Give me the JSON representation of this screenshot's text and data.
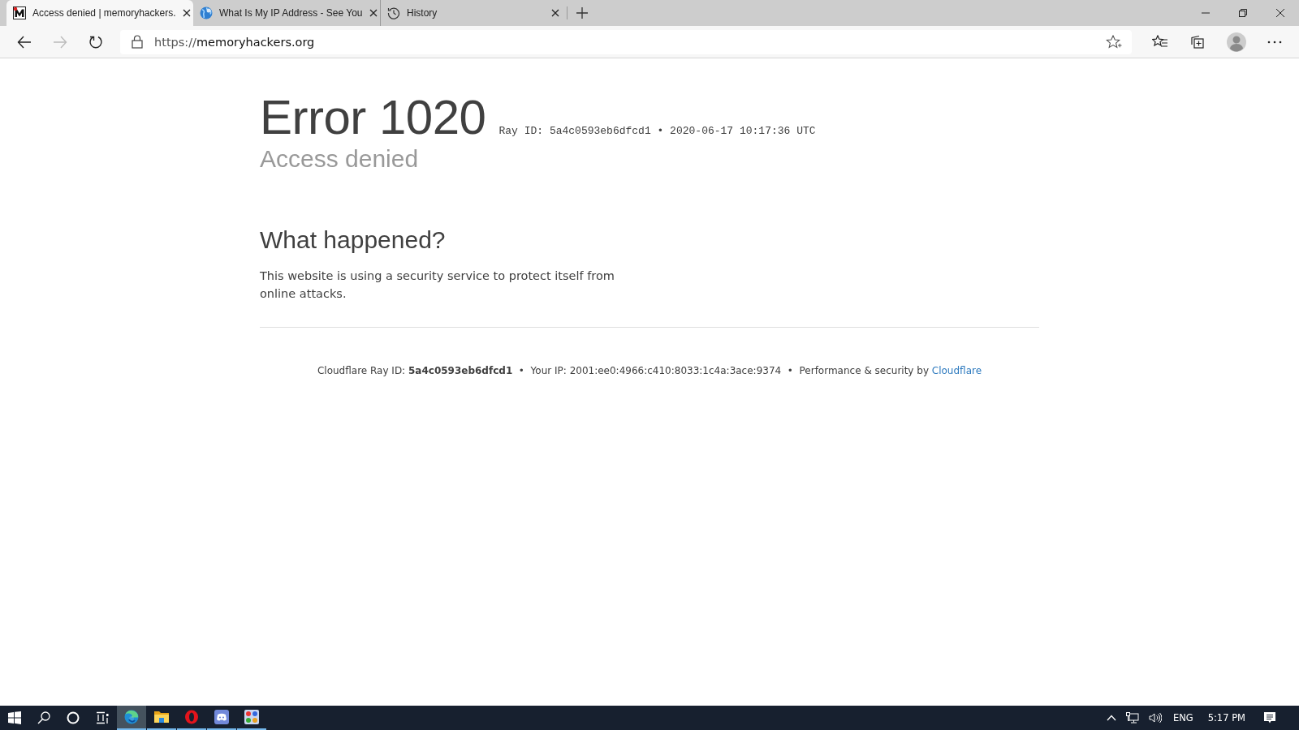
{
  "tabs": [
    {
      "title": "Access denied | memoryhackers.",
      "kind": "site",
      "selected": true
    },
    {
      "title": "What Is My IP Address - See You",
      "kind": "globe",
      "selected": false
    },
    {
      "title": "History",
      "kind": "history",
      "selected": false
    }
  ],
  "address_bar": {
    "url_prefix": "https://",
    "url_host": "memoryhackers.org"
  },
  "page": {
    "error_title": "Error 1020",
    "ray_line": "Ray ID: 5a4c0593eb6dfcd1 • 2020-06-17 10:17:36 UTC",
    "subtitle": "Access denied",
    "section_heading": "What happened?",
    "section_text": "This website is using a security service to protect itself from online attacks.",
    "footer_text": "Cloudflare Ray ID: **5a4c0593eb6dfcd1**  •  Your IP: 2001:ee0:4966:c410:8033:1c4a:3ace:9374  •  Performance & security by ",
    "footer_link": "Cloudflare"
  },
  "taskbar": {
    "apps": [
      {
        "kind": "browser",
        "selected": true
      },
      {
        "kind": "folder",
        "selected": false
      },
      {
        "kind": "opera",
        "selected": false
      },
      {
        "kind": "chat",
        "selected": false
      },
      {
        "kind": "grid",
        "selected": false
      }
    ],
    "language": "ENG",
    "clock": "5:17 PM"
  }
}
